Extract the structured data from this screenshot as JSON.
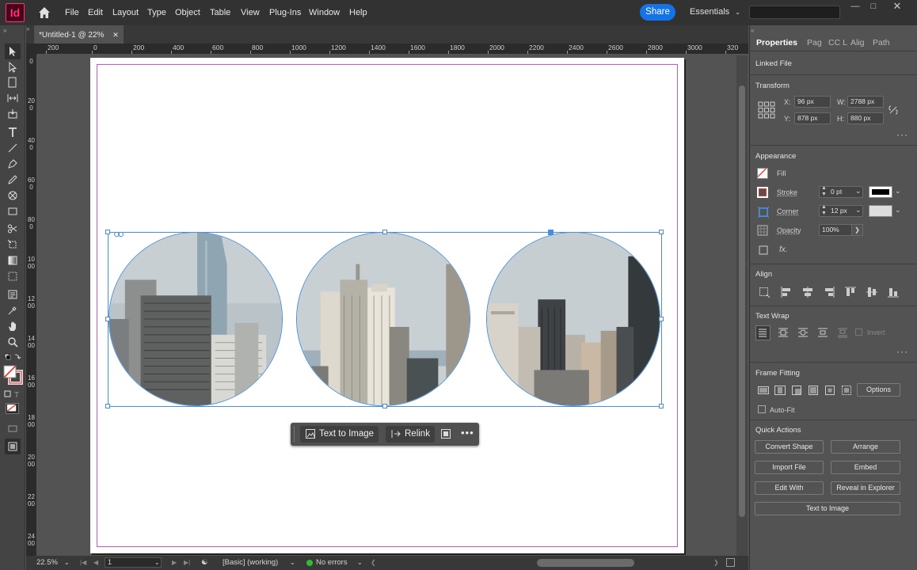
{
  "app": {
    "logo": "Id",
    "window_title": "*Untitled-1 @ 22%"
  },
  "menu": [
    "File",
    "Edit",
    "Layout",
    "Type",
    "Object",
    "Table",
    "View",
    "Plug-Ins",
    "Window",
    "Help"
  ],
  "header": {
    "share_label": "Share",
    "workspace_label": "Essentials"
  },
  "rulers": {
    "top": [
      "200",
      "0",
      "200",
      "400",
      "600",
      "800",
      "1000",
      "1200",
      "1400",
      "1600",
      "1800",
      "2000",
      "2200",
      "2400",
      "2600",
      "2800",
      "3000",
      "320"
    ],
    "left": [
      "0",
      "200",
      "400",
      "600",
      "800",
      "1000",
      "1200",
      "1400",
      "1600",
      "1800",
      "2000",
      "2200",
      "2400"
    ]
  },
  "taskbar": {
    "text_to_image": "Text to Image",
    "relink": "Relink"
  },
  "status": {
    "zoom": "22.5%",
    "page": "1",
    "preflight_profile": "[Basic] (working)",
    "errors": "No errors"
  },
  "panel": {
    "tabs": [
      "Properties",
      "Pag",
      "CC L",
      "Alig",
      "Path"
    ],
    "linked_file": "Linked File",
    "transform": {
      "title": "Transform",
      "x_label": "X:",
      "x": "96 px",
      "y_label": "Y:",
      "y": "878 px",
      "w_label": "W:",
      "w": "2788 px",
      "h_label": "H:",
      "h": "880 px"
    },
    "appearance": {
      "title": "Appearance",
      "fill": "Fill",
      "stroke": "Stroke",
      "stroke_value": "0 pt",
      "corner": "Corner",
      "corner_value": "12 px",
      "opacity": "Opacity",
      "opacity_value": "100%",
      "fx": "fx."
    },
    "align": {
      "title": "Align"
    },
    "text_wrap": {
      "title": "Text Wrap",
      "invert": "Invert"
    },
    "frame_fitting": {
      "title": "Frame Fitting",
      "options": "Options",
      "auto_fit": "Auto-Fit"
    },
    "quick_actions": {
      "title": "Quick Actions",
      "buttons": [
        "Convert Shape",
        "Arrange",
        "Import File",
        "Embed",
        "Edit With",
        "Reveal in Explorer"
      ],
      "text_to_image": "Text to Image"
    }
  },
  "colors": {
    "accent": "#1473e6",
    "selection": "#4a90d9",
    "margin": "#c95ac9",
    "no_errors": "#2dbd2d",
    "logo": "#ff3366"
  }
}
